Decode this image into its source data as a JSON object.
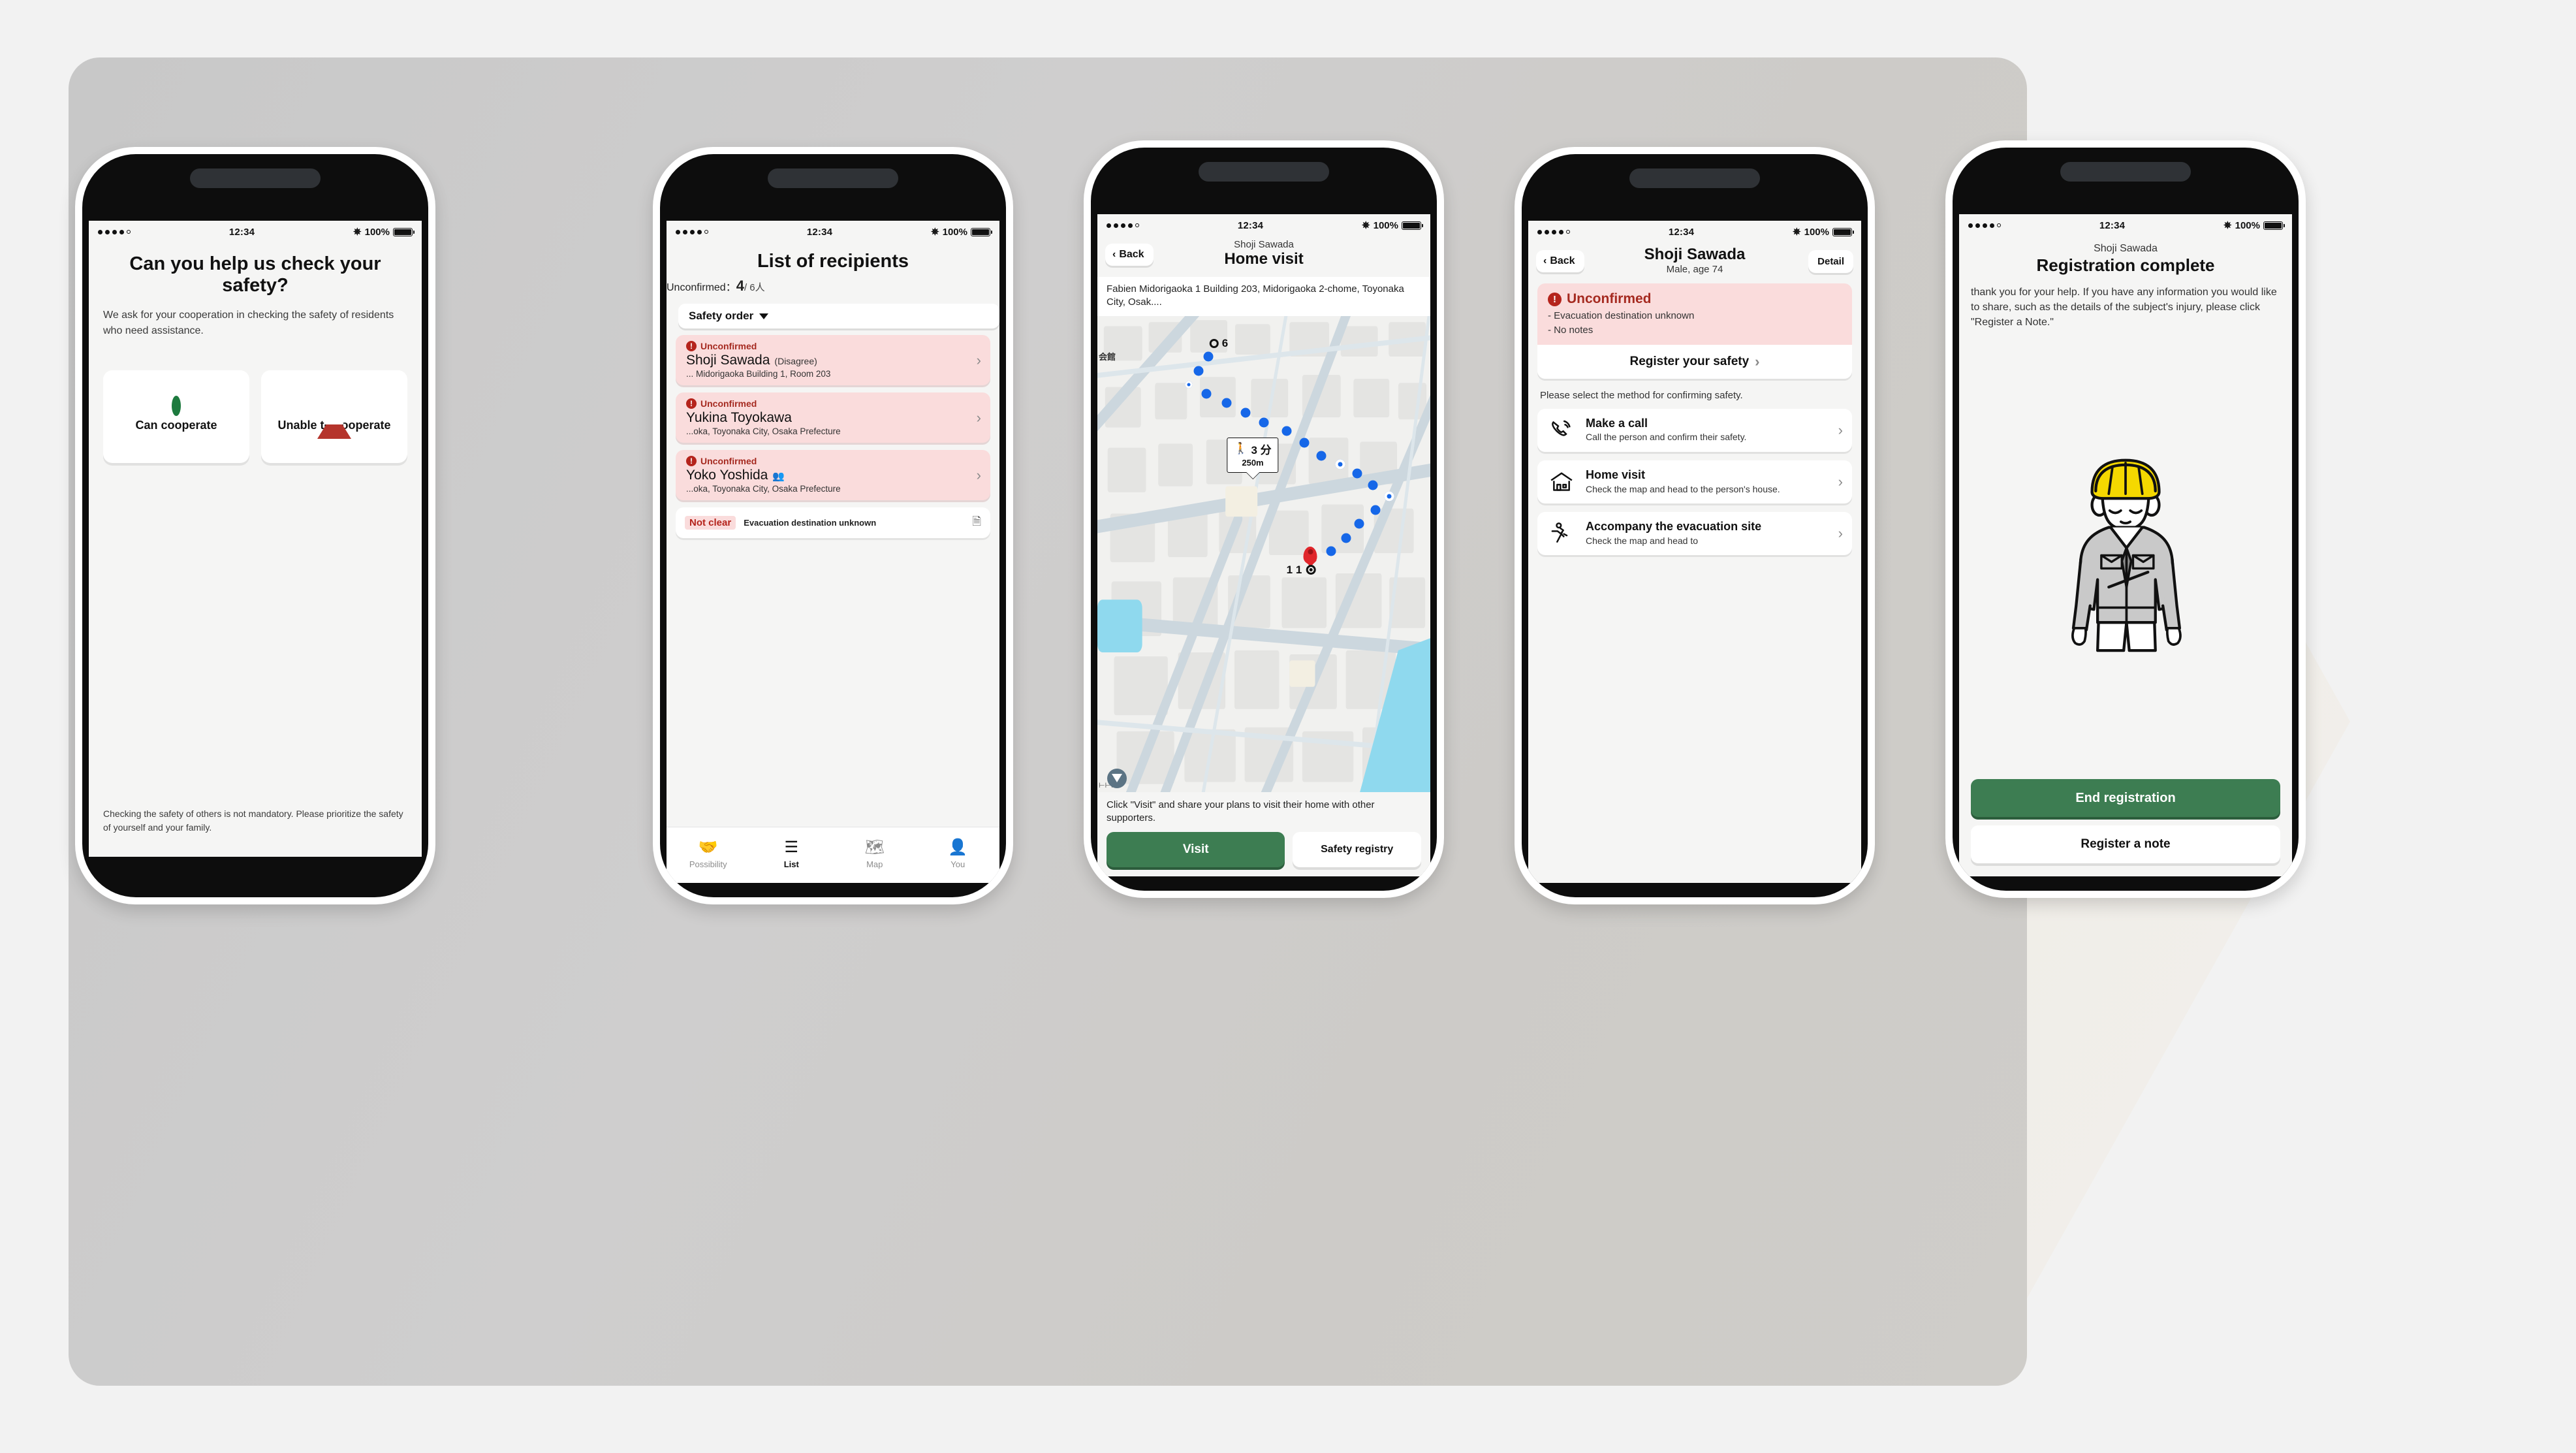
{
  "status_bar": {
    "time": "12:34",
    "battery": "100%",
    "bluetooth_icon": "bluetooth-icon"
  },
  "phone1": {
    "title": "Can you help us check your safety?",
    "lead": "We ask for your cooperation in checking the safety of residents who need assistance.",
    "choices": [
      {
        "label": "Can cooperate",
        "icon": "circle-ok-icon"
      },
      {
        "label": "Unable to cooperate",
        "icon": "triangle-warning-icon"
      }
    ],
    "note": "Checking the safety of others is not mandatory. Please prioritize the safety of yourself and your family."
  },
  "phone2": {
    "title": "List of recipients",
    "count_label": "Unconfirmed：",
    "count_value": "4",
    "count_total": "/ 6人",
    "sort_label": "Safety order",
    "recipients": [
      {
        "status": "Unconfirmed",
        "name": "Shoji Sawada",
        "name_suffix": "(Disagree)",
        "address": "... Midorigaoka Building 1, Room 203",
        "has_group_icon": false
      },
      {
        "status": "Unconfirmed",
        "name": "Yukina Toyokawa",
        "name_suffix": "",
        "address": "...oka, Toyonaka City, Osaka Prefecture",
        "has_group_icon": false
      },
      {
        "status": "Unconfirmed",
        "name": "Yoko Yoshida",
        "name_suffix": "",
        "address": "...oka, Toyonaka City, Osaka Prefecture",
        "has_group_icon": true
      }
    ],
    "partial_row": {
      "tag": "Not clear",
      "text": "Evacuation destination unknown",
      "icon": "note-icon"
    },
    "tabs": [
      {
        "label": "Possibility",
        "icon": "handshake-icon",
        "active": false
      },
      {
        "label": "List",
        "icon": "list-icon",
        "active": true
      },
      {
        "label": "Map",
        "icon": "map-icon",
        "active": false
      },
      {
        "label": "You",
        "icon": "person-icon",
        "active": false
      }
    ]
  },
  "phone3": {
    "back_label": "Back",
    "nav_person": "Shoji Sawada",
    "nav_title": "Home visit",
    "address": "Fabien Midorigaoka 1 Building 203, Midorigaoka 2-chome, Toyonaka City, Osak....",
    "map": {
      "label_start": "6",
      "label_end": "1 1",
      "callout_time": "3 分",
      "callout_distance": "250m",
      "poi_label": "会館",
      "walk_icon": "walking-person-icon"
    },
    "footer_text": "Click \"Visit\" and share your plans to visit their home with other supporters.",
    "primary_button": "Visit",
    "secondary_button": "Safety registry"
  },
  "phone4": {
    "back_label": "Back",
    "nav_title": "Shoji Sawada",
    "nav_sub": "Male, age 74",
    "detail_label": "Detail",
    "alert": {
      "status": "Unconfirmed",
      "lines": [
        "- Evacuation destination unknown",
        "- No notes"
      ],
      "action": "Register your safety"
    },
    "prompt": "Please select the method for confirming safety.",
    "methods": [
      {
        "icon": "phone-call-icon",
        "title": "Make a call",
        "desc": "Call the person and confirm their safety."
      },
      {
        "icon": "house-icon",
        "title": "Home visit",
        "desc": "Check the map and head to the person's house."
      },
      {
        "icon": "running-person-icon",
        "title": "Accompany the evacuation site",
        "desc": "Check the map and head to"
      }
    ]
  },
  "phone5": {
    "nav_person": "Shoji Sawada",
    "title": "Registration complete",
    "body": "thank you for your help. If you have any information you would like to share, such as the details of the subject's injury, please click \"Register a Note.\"",
    "illustration": "bowing-worker-illustration",
    "primary_button": "End registration",
    "secondary_button": "Register a note"
  },
  "colors": {
    "green": "#3d7d52",
    "alert_red": "#b5241c",
    "alert_bg": "#fadcdc",
    "helmet_yellow": "#f5d800",
    "route_blue": "#1667e8",
    "pin_red": "#e0262b"
  }
}
